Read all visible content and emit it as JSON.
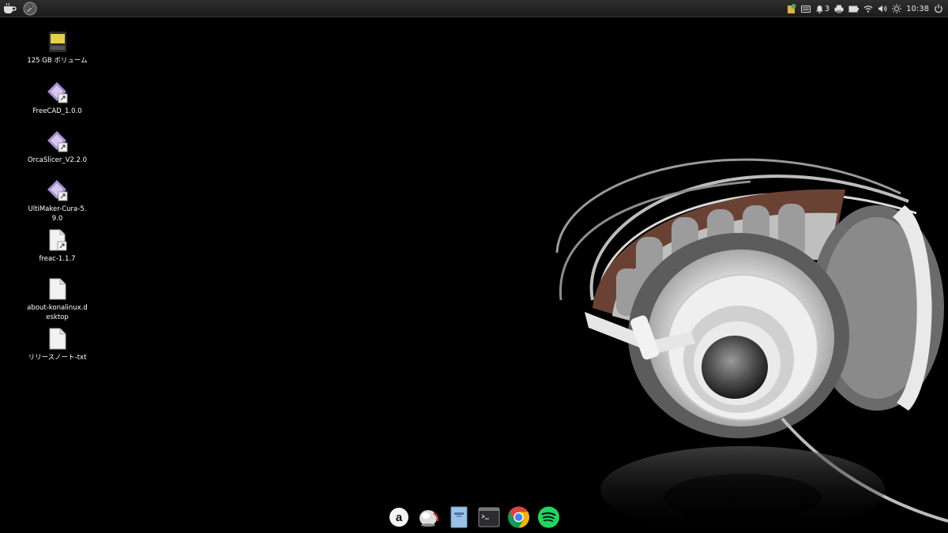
{
  "panel": {
    "clock": "10:38",
    "notification_count": "3",
    "left_icons": [
      "cup-icon",
      "rocket-launcher-icon"
    ],
    "tray_icons": [
      "software-update-icon",
      "keyboard-icon",
      "notifications-icon",
      "printer-icon",
      "battery-icon",
      "wifi-icon",
      "volume-icon",
      "brightness-icon",
      "power-icon"
    ]
  },
  "desktop": {
    "icons": [
      {
        "label": "125 GB ボリューム",
        "icon": "drive-icon"
      },
      {
        "label": "FreeCAD_1.0.0",
        "icon": "appimage-icon"
      },
      {
        "label": "OrcaSlicer_V2.2.0",
        "icon": "appimage-icon"
      },
      {
        "label": "UltiMaker-Cura-5.9.0",
        "icon": "appimage-icon"
      },
      {
        "label": "freac-1.1.7",
        "icon": "file-link-icon"
      },
      {
        "label": "about-konalinux.desktop",
        "icon": "document-icon"
      },
      {
        "label": "リリースノート-txt",
        "icon": "document-icon"
      }
    ]
  },
  "dock": {
    "items": [
      "a-launcher-icon",
      "browser-globe-icon",
      "file-manager-icon",
      "terminal-icon",
      "chrome-icon",
      "spotify-icon"
    ]
  },
  "colors": {
    "panel_bg": "#1f1f1f",
    "desktop_bg": "#000000",
    "spotify": "#1ed760",
    "chrome_red": "#db4437",
    "chrome_yellow": "#f4b400",
    "chrome_green": "#0f9d58",
    "chrome_blue": "#4285f4"
  }
}
